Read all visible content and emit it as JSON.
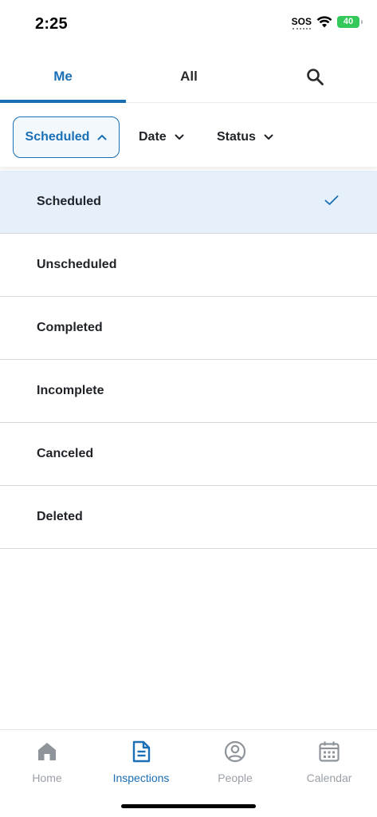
{
  "status_bar": {
    "time": "2:25",
    "sos": "SOS",
    "battery": "40"
  },
  "tabs": {
    "me": "Me",
    "all": "All",
    "active": "Me",
    "accent_color": "#1a6fb5"
  },
  "filters": {
    "scheduled": "Scheduled",
    "date": "Date",
    "status": "Status",
    "expanded": "Scheduled"
  },
  "dropdown": {
    "selected": "Scheduled",
    "options": [
      {
        "label": "Scheduled"
      },
      {
        "label": "Unscheduled"
      },
      {
        "label": "Completed"
      },
      {
        "label": "Incomplete"
      },
      {
        "label": "Canceled"
      },
      {
        "label": "Deleted"
      }
    ]
  },
  "bottom_nav": {
    "active": "Inspections",
    "items": [
      {
        "label": "Home",
        "icon": "home-icon"
      },
      {
        "label": "Inspections",
        "icon": "document-icon"
      },
      {
        "label": "People",
        "icon": "person-circle-icon"
      },
      {
        "label": "Calendar",
        "icon": "calendar-icon"
      }
    ]
  }
}
